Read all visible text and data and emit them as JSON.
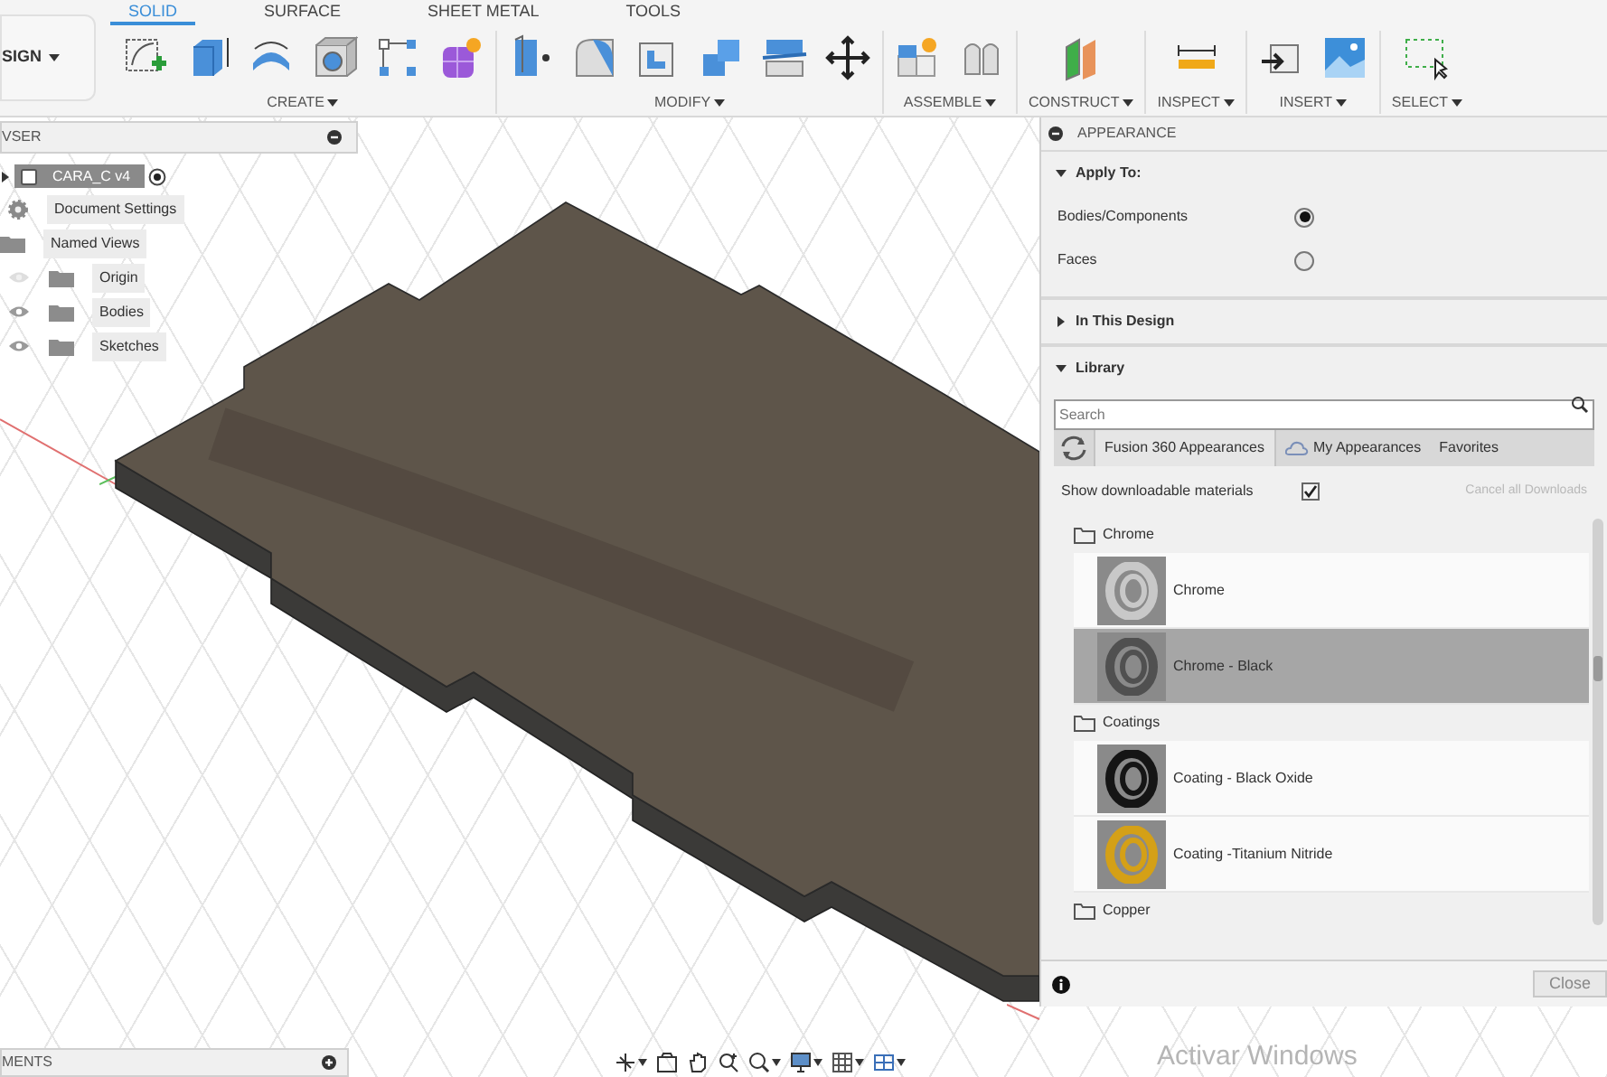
{
  "toolbar": {
    "workspace": "SIGN",
    "tabs": [
      {
        "label": "SOLID",
        "selected": true
      },
      {
        "label": "SURFACE",
        "selected": false
      },
      {
        "label": "SHEET METAL",
        "selected": false
      },
      {
        "label": "TOOLS",
        "selected": false
      }
    ],
    "groups": [
      "CREATE",
      "MODIFY",
      "ASSEMBLE",
      "CONSTRUCT",
      "INSPECT",
      "INSERT",
      "SELECT"
    ]
  },
  "browser": {
    "title": "VSER",
    "root": {
      "label": "CARA_C v4",
      "children": [
        {
          "label": "Document Settings",
          "kind": "settings"
        },
        {
          "label": "Named Views",
          "kind": "views"
        },
        {
          "label": "Origin",
          "kind": "toggle",
          "visible": false
        },
        {
          "label": "Bodies",
          "kind": "toggle",
          "visible": true
        },
        {
          "label": "Sketches",
          "kind": "toggle",
          "visible": true
        }
      ]
    }
  },
  "appearance": {
    "title": "APPEARANCE",
    "apply_to": {
      "label": "Apply To:",
      "expanded": true,
      "options": [
        {
          "label": "Bodies/Components",
          "selected": true
        },
        {
          "label": "Faces",
          "selected": false
        }
      ]
    },
    "in_this_design": {
      "label": "In This Design",
      "expanded": false
    },
    "library": {
      "label": "Library",
      "expanded": true,
      "search_placeholder": "Search",
      "tabs": [
        {
          "label": "Fusion 360 Appearances",
          "selected": true
        },
        {
          "label": "My Appearances",
          "selected": false
        },
        {
          "label": "Favorites",
          "selected": false
        }
      ],
      "show_downloadable": {
        "label": "Show downloadable materials",
        "checked": true
      },
      "cancel_downloads": {
        "label": "Cancel all Downloads",
        "disabled": true
      },
      "folders": [
        {
          "label": "Chrome",
          "children": [
            {
              "label": "Chrome",
              "selected": false,
              "color": "#c8c8c8"
            },
            {
              "label": "Chrome - Black",
              "selected": true,
              "color": "#505050"
            }
          ]
        },
        {
          "label": "Coatings",
          "children": [
            {
              "label": "Coating - Black Oxide",
              "selected": false,
              "color": "#151515"
            },
            {
              "label": "Coating -Titanium Nitride",
              "selected": false,
              "color": "#d4a017"
            }
          ]
        },
        {
          "label": "Copper"
        }
      ]
    },
    "close_button": "Close"
  },
  "comments": {
    "title": "MENTS"
  },
  "os_notice": "Activar Windows"
}
